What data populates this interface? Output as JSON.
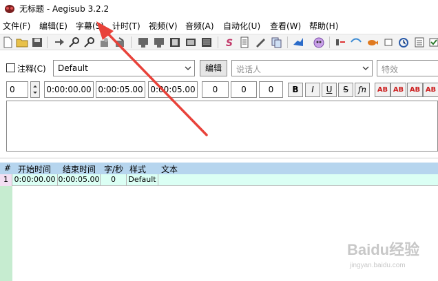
{
  "window": {
    "title": "无标题 - Aegisub 3.2.2"
  },
  "menu": [
    "文件(F)",
    "编辑(E)",
    "字幕(S)",
    "计时(T)",
    "视频(V)",
    "音频(A)",
    "自动化(U)",
    "查看(W)",
    "帮助(H)"
  ],
  "toolbar_icons": [
    "new-file-icon",
    "open-folder-icon",
    "save-icon",
    "jump-arrow-icon",
    "find-icon",
    "find-replace-icon",
    "attachments-icon",
    "fonts-collector-icon",
    "open-video-icon",
    "close-video-icon",
    "video-details-icon",
    "keyframes-icon",
    "subtitles-icon",
    "styles-manager-icon",
    "properties-icon",
    "resample-icon",
    "translation-assistant-icon",
    "automation-icon",
    "assdraw-icon",
    "timing-postprocessor-icon",
    "kanji-timer-icon",
    "shift-times-icon",
    "snap-icon",
    "select-lines-icon",
    "options-icon",
    "tag-toggle-icon",
    "overwrite-icon"
  ],
  "edit": {
    "comment_label": "注释(C)",
    "style_value": "Default",
    "edit_button": "编辑",
    "actor_placeholder": "说话人",
    "effect_placeholder": "特效",
    "layer": "0",
    "start_time": "0:00:00.00",
    "end_time": "0:00:05.00",
    "duration": "0:00:05.00",
    "margin_left": "0",
    "margin_right": "0",
    "margin_vert": "0",
    "format_buttons": [
      "B",
      "I",
      "U",
      "S",
      "fn"
    ],
    "color_buttons": [
      "AB",
      "AB",
      "AB",
      "AB"
    ],
    "color_values": [
      "#cc2020",
      "#cc2020",
      "#cc2020",
      "#cc2020"
    ]
  },
  "grid": {
    "columns": [
      "#",
      "开始时间",
      "结束时间",
      "字/秒",
      "样式",
      "文本"
    ],
    "rows": [
      {
        "num": "1",
        "start": "0:00:00.00",
        "end": "0:00:05.00",
        "cps": "0",
        "style": "Default",
        "text": ""
      }
    ]
  },
  "watermark": {
    "text": "Baidu经验",
    "subtext": "jingyan.baidu.com"
  },
  "colors": {
    "grid_header": "#b6d5ee",
    "active_row": "#dbfff4",
    "row_num_strip": "#c6ecd0",
    "annotation_arrow": "#e8423a"
  }
}
